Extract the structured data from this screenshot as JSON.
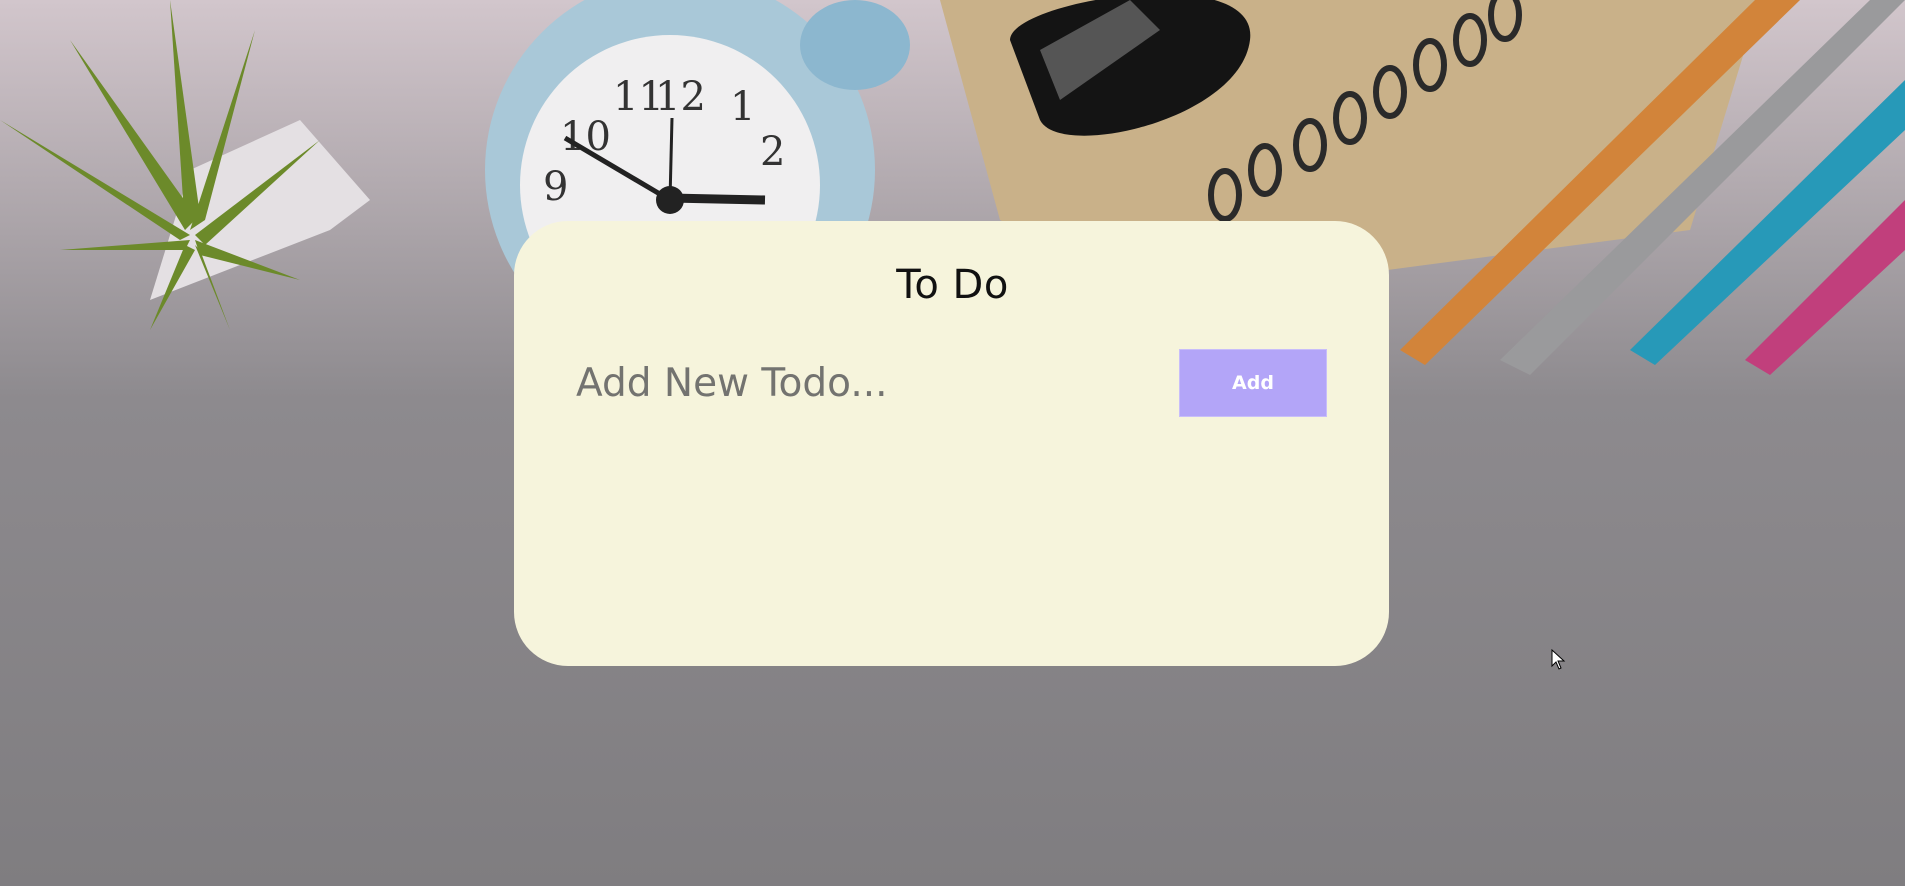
{
  "app": {
    "title": "To Do"
  },
  "todo_form": {
    "input_value": "",
    "input_placeholder": "Add New Todo...",
    "add_label": "Add"
  },
  "todos": [],
  "colors": {
    "card_background": "#f6f4dc",
    "add_button": "#b3a5f8",
    "page_overlay": "#7f7d80"
  },
  "background": {
    "description_icons": [
      "plant-icon",
      "alarm-clock-icon",
      "glasses-icon",
      "notebook-icon",
      "pens-icon"
    ]
  }
}
